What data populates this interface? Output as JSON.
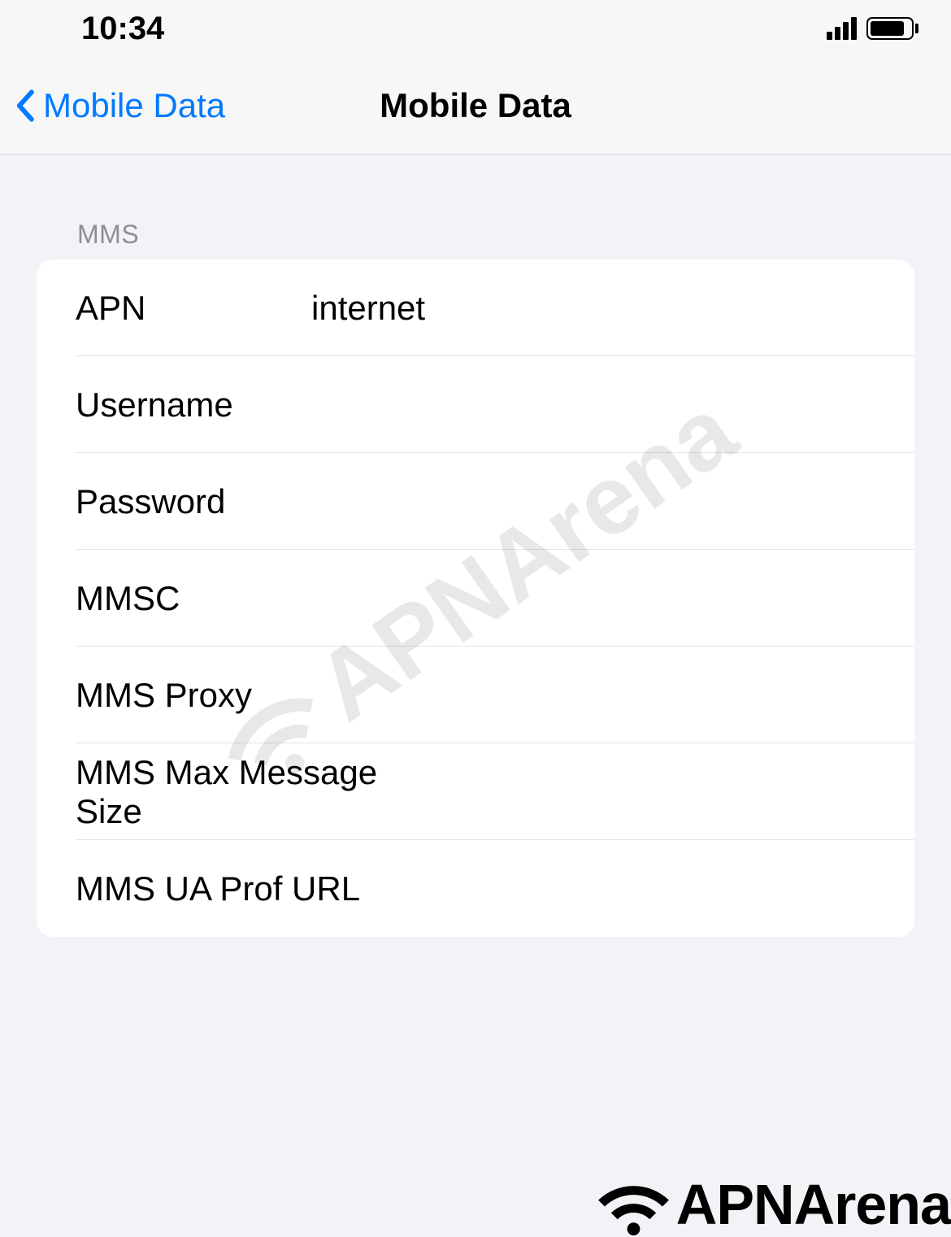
{
  "statusBar": {
    "time": "10:34"
  },
  "nav": {
    "backLabel": "Mobile Data",
    "title": "Mobile Data"
  },
  "section": {
    "header": "MMS"
  },
  "fields": {
    "apn": {
      "label": "APN",
      "value": "internet"
    },
    "username": {
      "label": "Username",
      "value": ""
    },
    "password": {
      "label": "Password",
      "value": ""
    },
    "mmsc": {
      "label": "MMSC",
      "value": ""
    },
    "mmsProxy": {
      "label": "MMS Proxy",
      "value": ""
    },
    "mmsMaxSize": {
      "label": "MMS Max Message Size",
      "value": ""
    },
    "mmsUaProf": {
      "label": "MMS UA Prof URL",
      "value": ""
    }
  },
  "watermark": {
    "text": "APNArena"
  },
  "logo": {
    "text": "APNArena"
  }
}
